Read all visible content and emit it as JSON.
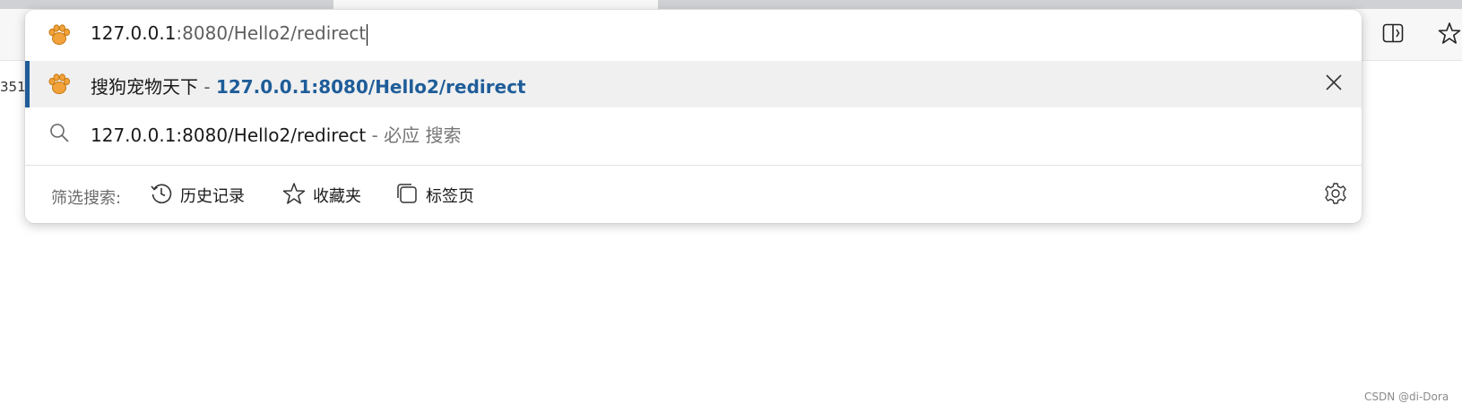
{
  "omnibox": {
    "input_typed": "127.0.0.1",
    "input_rest": ":8080/Hello2/redirect",
    "suggestions": [
      {
        "title": "搜狗宠物天下",
        "separator": " - ",
        "url": "127.0.0.1:8080/Hello2/redirect",
        "icon": "paw-favicon-icon"
      },
      {
        "query": "127.0.0.1:8080/Hello2/redirect",
        "separator": " - ",
        "engine": "必应 搜索",
        "icon": "search-icon"
      }
    ],
    "filter": {
      "label": "筛选搜索:",
      "history": "历史记录",
      "favorites": "收藏夹",
      "tabs": "标签页"
    }
  },
  "page": {
    "fragment": "351"
  },
  "watermark": "CSDN @di-Dora",
  "colors": {
    "accent": "#1f5d99",
    "favicon": "#f2a23a"
  }
}
